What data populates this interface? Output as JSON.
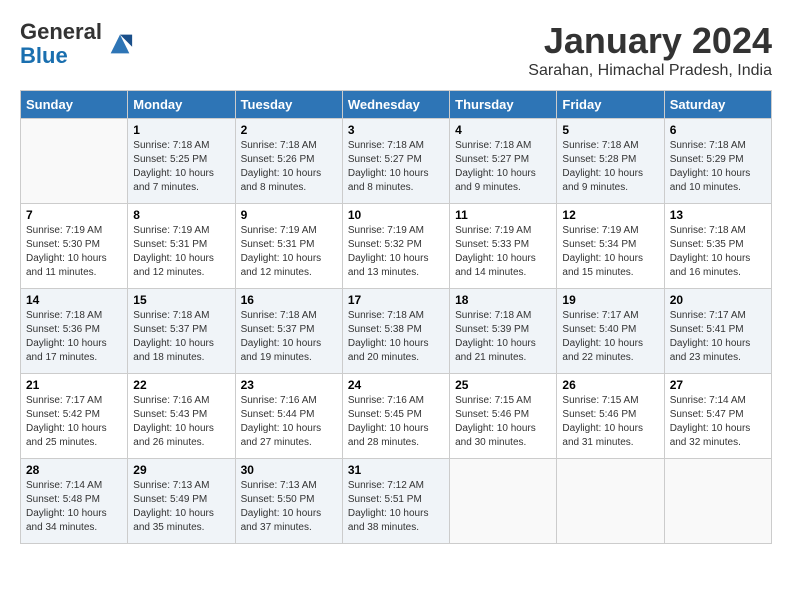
{
  "logo": {
    "general": "General",
    "blue": "Blue"
  },
  "title": "January 2024",
  "location": "Sarahan, Himachal Pradesh, India",
  "days_of_week": [
    "Sunday",
    "Monday",
    "Tuesday",
    "Wednesday",
    "Thursday",
    "Friday",
    "Saturday"
  ],
  "weeks": [
    [
      {
        "day": "",
        "sunrise": "",
        "sunset": "",
        "daylight": ""
      },
      {
        "day": "1",
        "sunrise": "Sunrise: 7:18 AM",
        "sunset": "Sunset: 5:25 PM",
        "daylight": "Daylight: 10 hours and 7 minutes."
      },
      {
        "day": "2",
        "sunrise": "Sunrise: 7:18 AM",
        "sunset": "Sunset: 5:26 PM",
        "daylight": "Daylight: 10 hours and 8 minutes."
      },
      {
        "day": "3",
        "sunrise": "Sunrise: 7:18 AM",
        "sunset": "Sunset: 5:27 PM",
        "daylight": "Daylight: 10 hours and 8 minutes."
      },
      {
        "day": "4",
        "sunrise": "Sunrise: 7:18 AM",
        "sunset": "Sunset: 5:27 PM",
        "daylight": "Daylight: 10 hours and 9 minutes."
      },
      {
        "day": "5",
        "sunrise": "Sunrise: 7:18 AM",
        "sunset": "Sunset: 5:28 PM",
        "daylight": "Daylight: 10 hours and 9 minutes."
      },
      {
        "day": "6",
        "sunrise": "Sunrise: 7:18 AM",
        "sunset": "Sunset: 5:29 PM",
        "daylight": "Daylight: 10 hours and 10 minutes."
      }
    ],
    [
      {
        "day": "7",
        "sunrise": "Sunrise: 7:19 AM",
        "sunset": "Sunset: 5:30 PM",
        "daylight": "Daylight: 10 hours and 11 minutes."
      },
      {
        "day": "8",
        "sunrise": "Sunrise: 7:19 AM",
        "sunset": "Sunset: 5:31 PM",
        "daylight": "Daylight: 10 hours and 12 minutes."
      },
      {
        "day": "9",
        "sunrise": "Sunrise: 7:19 AM",
        "sunset": "Sunset: 5:31 PM",
        "daylight": "Daylight: 10 hours and 12 minutes."
      },
      {
        "day": "10",
        "sunrise": "Sunrise: 7:19 AM",
        "sunset": "Sunset: 5:32 PM",
        "daylight": "Daylight: 10 hours and 13 minutes."
      },
      {
        "day": "11",
        "sunrise": "Sunrise: 7:19 AM",
        "sunset": "Sunset: 5:33 PM",
        "daylight": "Daylight: 10 hours and 14 minutes."
      },
      {
        "day": "12",
        "sunrise": "Sunrise: 7:19 AM",
        "sunset": "Sunset: 5:34 PM",
        "daylight": "Daylight: 10 hours and 15 minutes."
      },
      {
        "day": "13",
        "sunrise": "Sunrise: 7:18 AM",
        "sunset": "Sunset: 5:35 PM",
        "daylight": "Daylight: 10 hours and 16 minutes."
      }
    ],
    [
      {
        "day": "14",
        "sunrise": "Sunrise: 7:18 AM",
        "sunset": "Sunset: 5:36 PM",
        "daylight": "Daylight: 10 hours and 17 minutes."
      },
      {
        "day": "15",
        "sunrise": "Sunrise: 7:18 AM",
        "sunset": "Sunset: 5:37 PM",
        "daylight": "Daylight: 10 hours and 18 minutes."
      },
      {
        "day": "16",
        "sunrise": "Sunrise: 7:18 AM",
        "sunset": "Sunset: 5:37 PM",
        "daylight": "Daylight: 10 hours and 19 minutes."
      },
      {
        "day": "17",
        "sunrise": "Sunrise: 7:18 AM",
        "sunset": "Sunset: 5:38 PM",
        "daylight": "Daylight: 10 hours and 20 minutes."
      },
      {
        "day": "18",
        "sunrise": "Sunrise: 7:18 AM",
        "sunset": "Sunset: 5:39 PM",
        "daylight": "Daylight: 10 hours and 21 minutes."
      },
      {
        "day": "19",
        "sunrise": "Sunrise: 7:17 AM",
        "sunset": "Sunset: 5:40 PM",
        "daylight": "Daylight: 10 hours and 22 minutes."
      },
      {
        "day": "20",
        "sunrise": "Sunrise: 7:17 AM",
        "sunset": "Sunset: 5:41 PM",
        "daylight": "Daylight: 10 hours and 23 minutes."
      }
    ],
    [
      {
        "day": "21",
        "sunrise": "Sunrise: 7:17 AM",
        "sunset": "Sunset: 5:42 PM",
        "daylight": "Daylight: 10 hours and 25 minutes."
      },
      {
        "day": "22",
        "sunrise": "Sunrise: 7:16 AM",
        "sunset": "Sunset: 5:43 PM",
        "daylight": "Daylight: 10 hours and 26 minutes."
      },
      {
        "day": "23",
        "sunrise": "Sunrise: 7:16 AM",
        "sunset": "Sunset: 5:44 PM",
        "daylight": "Daylight: 10 hours and 27 minutes."
      },
      {
        "day": "24",
        "sunrise": "Sunrise: 7:16 AM",
        "sunset": "Sunset: 5:45 PM",
        "daylight": "Daylight: 10 hours and 28 minutes."
      },
      {
        "day": "25",
        "sunrise": "Sunrise: 7:15 AM",
        "sunset": "Sunset: 5:46 PM",
        "daylight": "Daylight: 10 hours and 30 minutes."
      },
      {
        "day": "26",
        "sunrise": "Sunrise: 7:15 AM",
        "sunset": "Sunset: 5:46 PM",
        "daylight": "Daylight: 10 hours and 31 minutes."
      },
      {
        "day": "27",
        "sunrise": "Sunrise: 7:14 AM",
        "sunset": "Sunset: 5:47 PM",
        "daylight": "Daylight: 10 hours and 32 minutes."
      }
    ],
    [
      {
        "day": "28",
        "sunrise": "Sunrise: 7:14 AM",
        "sunset": "Sunset: 5:48 PM",
        "daylight": "Daylight: 10 hours and 34 minutes."
      },
      {
        "day": "29",
        "sunrise": "Sunrise: 7:13 AM",
        "sunset": "Sunset: 5:49 PM",
        "daylight": "Daylight: 10 hours and 35 minutes."
      },
      {
        "day": "30",
        "sunrise": "Sunrise: 7:13 AM",
        "sunset": "Sunset: 5:50 PM",
        "daylight": "Daylight: 10 hours and 37 minutes."
      },
      {
        "day": "31",
        "sunrise": "Sunrise: 7:12 AM",
        "sunset": "Sunset: 5:51 PM",
        "daylight": "Daylight: 10 hours and 38 minutes."
      },
      {
        "day": "",
        "sunrise": "",
        "sunset": "",
        "daylight": ""
      },
      {
        "day": "",
        "sunrise": "",
        "sunset": "",
        "daylight": ""
      },
      {
        "day": "",
        "sunrise": "",
        "sunset": "",
        "daylight": ""
      }
    ]
  ]
}
